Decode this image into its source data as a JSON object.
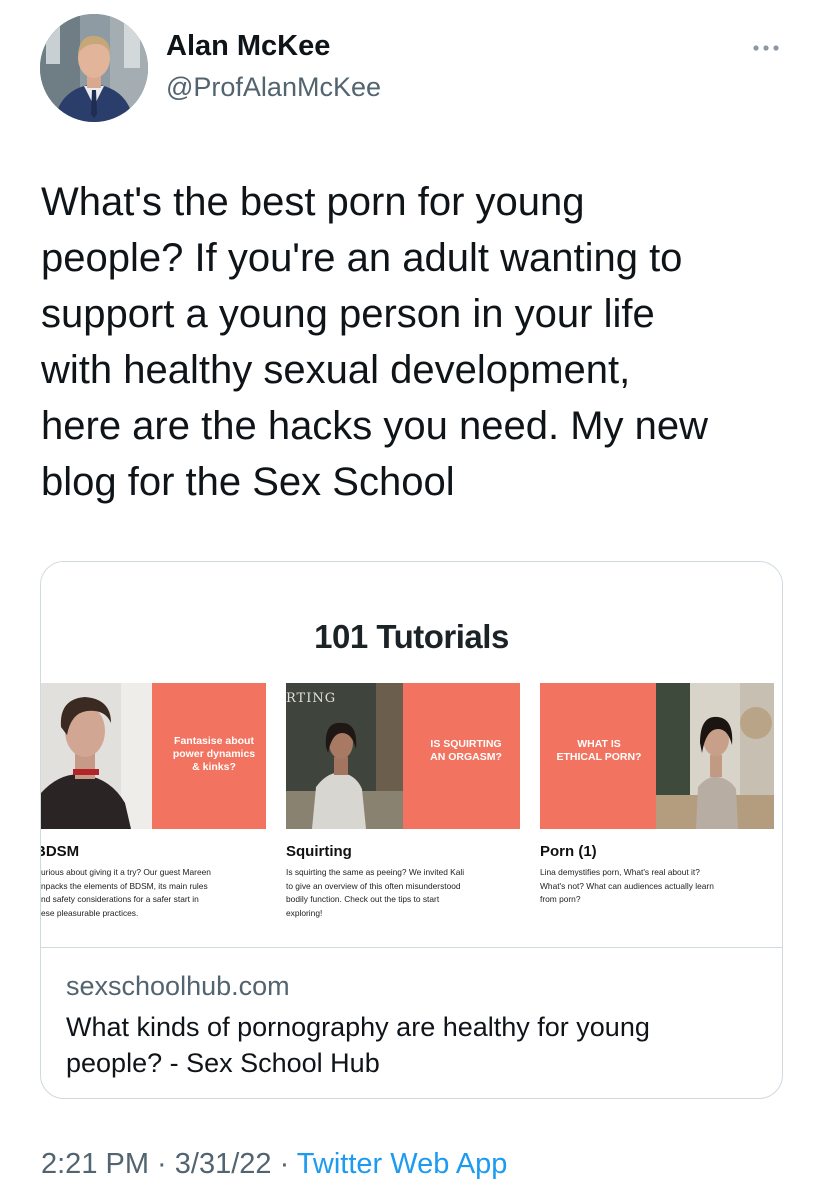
{
  "author": {
    "display_name": "Alan McKee",
    "handle": "@ProfAlanMcKee"
  },
  "icons": {
    "more": "more-horizontal-icon"
  },
  "tweet": {
    "lines": [
      "What's the best porn for young",
      "people? If you're an adult wanting to",
      "support a young person in your life",
      "with healthy sexual development,",
      "here are the hacks you need. My new",
      "blog for the Sex School"
    ]
  },
  "card": {
    "image": {
      "heading": "101 Tutorials",
      "tutorials": [
        {
          "tile_text": [
            "Fantasise about",
            "power dynamics",
            "& kinks?"
          ],
          "title": "BDSM",
          "description": [
            "urious about giving it a try? Our guest Mareen",
            "npacks the elements of BDSM, its main rules",
            "nd safety considerations for a safer start in",
            "ese pleasurable practices."
          ]
        },
        {
          "tile_text": [
            "IS SQUIRTING",
            "AN ORGASM?"
          ],
          "board_text": "RTING",
          "title": "Squirting",
          "description": [
            "Is squirting the same as peeing? We invited Kali",
            "to give an overview of this often misunderstood",
            "bodily function. Check out the tips to start",
            "exploring!"
          ]
        },
        {
          "tile_text": [
            "WHAT IS",
            "ETHICAL PORN?"
          ],
          "title": "Porn (1)",
          "description": [
            "Lina demystifies porn, What's real about it?",
            "What's not? What can audiences actually learn",
            "from porn?"
          ]
        }
      ]
    },
    "domain": "sexschoolhub.com",
    "title_lines": [
      "What kinds of pornography are healthy for young",
      "people? - Sex School Hub"
    ]
  },
  "meta": {
    "time": "2:21 PM",
    "separator": " · ",
    "date": "3/31/22",
    "source": "Twitter Web App"
  },
  "colors": {
    "accent": "#1d9bf0",
    "secondary_text": "#536471",
    "tile_coral": "#f2735f",
    "border": "#cfd9de"
  }
}
